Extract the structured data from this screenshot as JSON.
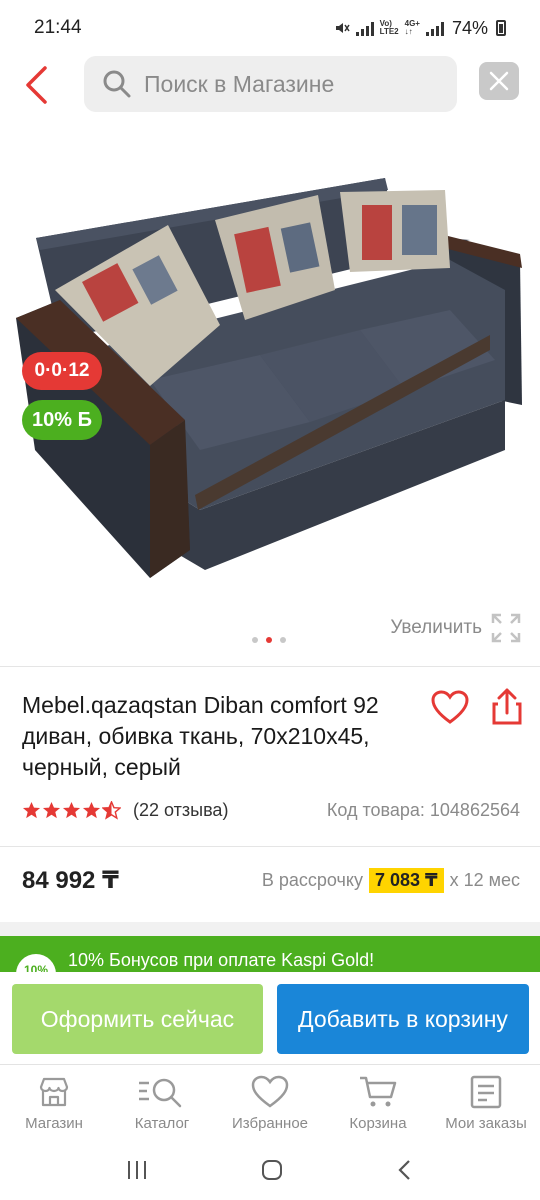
{
  "status_bar": {
    "time": "21:44",
    "battery": "74%"
  },
  "search": {
    "placeholder": "Поиск в Магазине"
  },
  "product": {
    "badges": {
      "installment": "0·0·12",
      "bonus": "10% Б"
    },
    "zoom_label": "Увеличить",
    "image_count": 3,
    "active_image": 2,
    "title": "Mebel.qazaqstan Diban comfort 92 диван, обивка ткань, 70x210x45, черный, серый",
    "rating": 4.5,
    "reviews": "(22 отзыва)",
    "sku": "Код товара: 104862564",
    "price": "84 992 ₸",
    "installment": {
      "prefix": "В рассрочку",
      "monthly": "7 083 ₸",
      "suffix": "х 12 мес"
    }
  },
  "bonus_banner": {
    "badge": "10%",
    "text": "10% Бонусов при оплате Kaspi Gold!"
  },
  "actions": {
    "checkout": "Оформить сейчас",
    "add_to_cart": "Добавить в корзину"
  },
  "bottom_nav": [
    {
      "label": "Магазин",
      "icon": "store-icon"
    },
    {
      "label": "Каталог",
      "icon": "catalog-search-icon"
    },
    {
      "label": "Избранное",
      "icon": "heart-icon"
    },
    {
      "label": "Корзина",
      "icon": "cart-icon"
    },
    {
      "label": "Мои заказы",
      "icon": "orders-icon"
    }
  ],
  "colors": {
    "accent_red": "#e53935",
    "bonus_green": "#4caf1f",
    "checkout_green": "#a4d96c",
    "cart_blue": "#1a86d8",
    "installment_yellow": "#ffd400"
  }
}
